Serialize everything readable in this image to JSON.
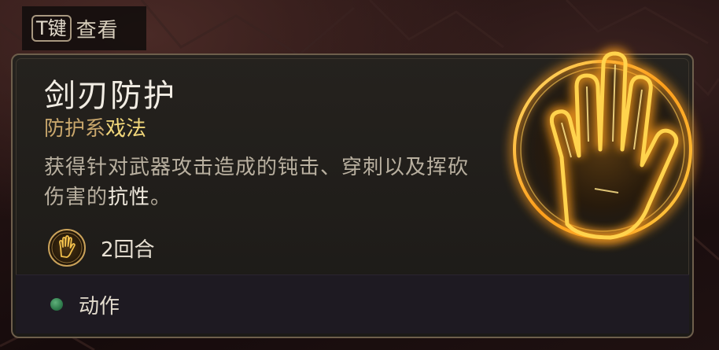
{
  "hint": {
    "key": "T键",
    "label": "查看"
  },
  "spell": {
    "name": "剑刃防护",
    "school_prefix": "防护系",
    "school_type": "戏法",
    "description_plain": "获得针对武器攻击造成的钝击、穿刺以及挥砍伤害的",
    "description_highlight": "抗性",
    "description_end": "。",
    "duration": "2回合",
    "action_type": "动作"
  },
  "colors": {
    "accent_gold": "#f0d67a",
    "action_dot": "#2f7b4c",
    "glow": "#ffb52e"
  },
  "icons": {
    "spell": "raised-hand-glowing-icon",
    "duration": "hand-duration-icon",
    "action": "green-dot-icon"
  }
}
